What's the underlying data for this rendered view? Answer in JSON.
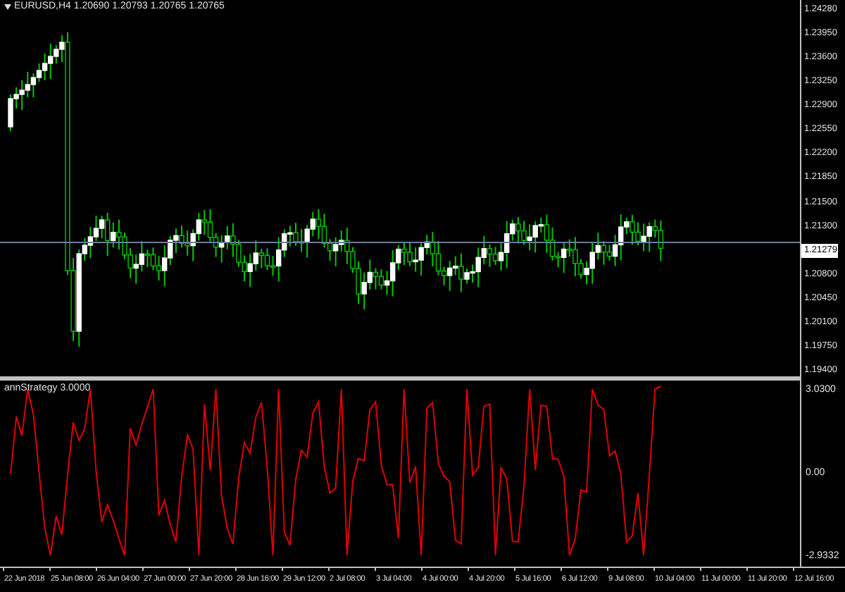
{
  "chart": {
    "title": "EURUSD,H4 1.20690 1.20793 1.20765 1.20765",
    "price_labels": [
      {
        "text": "1.24280",
        "kind": "tick"
      },
      {
        "text": "1.23950",
        "kind": "tick"
      },
      {
        "text": "1.23600",
        "kind": "tick"
      },
      {
        "text": "1.23250",
        "kind": "tick"
      },
      {
        "text": "1.22900",
        "kind": "tick"
      },
      {
        "text": "1.22550",
        "kind": "tick"
      },
      {
        "text": "1.22200",
        "kind": "tick"
      },
      {
        "text": "1.21850",
        "kind": "tick"
      },
      {
        "text": "1.21500",
        "kind": "tick"
      },
      {
        "text": "1.21300",
        "kind": "tick"
      },
      {
        "text": "1.21279",
        "kind": "current"
      },
      {
        "text": "1.20800",
        "kind": "tick"
      },
      {
        "text": "1.20450",
        "kind": "tick"
      },
      {
        "text": "1.20100",
        "kind": "tick"
      },
      {
        "text": "1.19750",
        "kind": "tick"
      },
      {
        "text": "1.19400",
        "kind": "tick"
      }
    ]
  },
  "indicator": {
    "title": "annStrategy 3.0000",
    "labels": [
      "3.0300",
      "0.00",
      "-2.9332"
    ]
  },
  "time_axis": {
    "labels": [
      "22 Jun 2018",
      "25 Jun 08:00",
      "26 Jun 04:00",
      "27 Jun 00:00",
      "27 Jun 20:00",
      "28 Jun 16:00",
      "29 Jun 12:00",
      "2 Jul 08:00",
      "3 Jul 04:00",
      "4 Jul 00:00",
      "4 Jul 20:00",
      "5 Jul 16:00",
      "6 Jul 12:00",
      "9 Jul 08:00",
      "10 Jul 04:00",
      "11 Jul 00:00",
      "11 Jul 20:00",
      "12 Jul 16:00"
    ]
  }
}
